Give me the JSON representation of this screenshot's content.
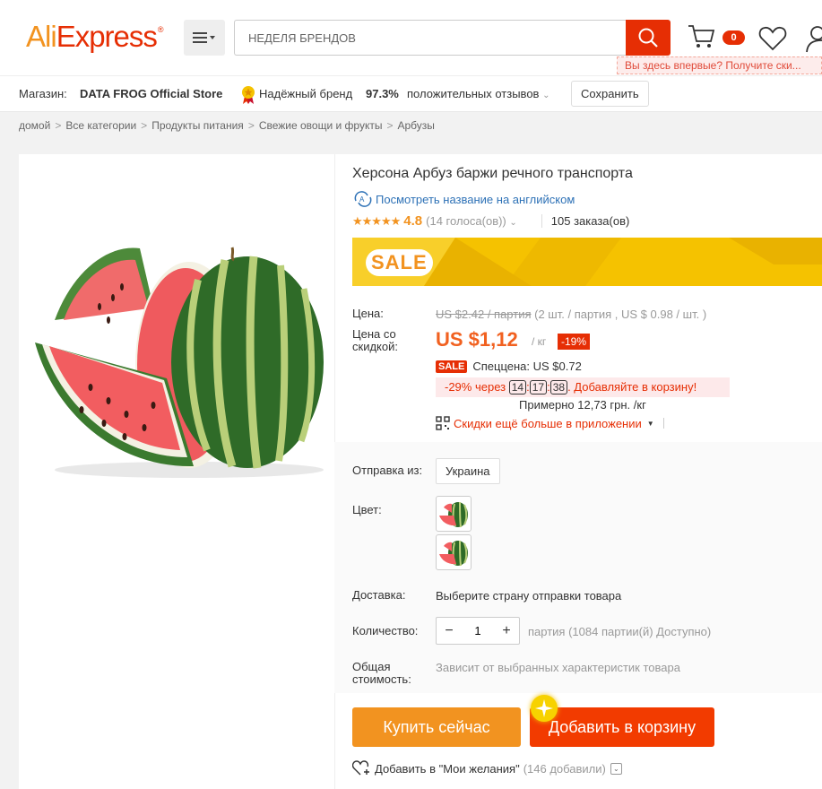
{
  "header": {
    "logo_part1": "Ali",
    "logo_part2": "Express",
    "logo_tm": "®",
    "search_placeholder": "НЕДЕЛЯ БРЕНДОВ",
    "cart_count": "0",
    "tooltip": "Вы здесь впервые? Получите ски..."
  },
  "store": {
    "label": "Магазин:",
    "name": "DATA FROG Official Store",
    "brand_badge": "Надёжный бренд",
    "positive_pct": "97.3%",
    "positive_label": "положительных отзывов",
    "save_button": "Сохранить"
  },
  "breadcrumb": [
    "домой",
    "Все категории",
    "Продукты питания",
    "Свежие овощи и фрукты",
    "Арбузы"
  ],
  "product": {
    "title": "Херсона Арбуз баржи речного транспорта",
    "english_link": "Посмотреть название на английском",
    "stars": "★★★★★",
    "rating": "4.8",
    "votes": "(14 голоса(ов))",
    "orders": "105 заказа(ов)",
    "sale_banner": "SALE"
  },
  "pricing": {
    "price_label": "Цена:",
    "old_price": "US $2.42 / партия",
    "old_price_note": "(2 шт. / партия , US $ 0.98 / шт. )",
    "discount_label": "Цена со скидкой:",
    "price": "US $1,12",
    "unit": "/ кг",
    "discount_pct": "-19%",
    "sale_tag": "SALE",
    "special_price": "Спеццена: US $0.72",
    "timer_pct": "-29%",
    "timer_word": "через",
    "timer_h": "14",
    "timer_m": "17",
    "timer_s": "38",
    "timer_action": ". Добавляйте в корзину!",
    "approx": "Примерно 12,73 грн. /кг",
    "app_discount": "Скидки ещё больше в приложении"
  },
  "options": {
    "ship_from_label": "Отправка из:",
    "ship_from_value": "Украина",
    "color_label": "Цвет:",
    "delivery_label": "Доставка:",
    "delivery_value": "Выберите страну отправки товара",
    "quantity_label": "Количество:",
    "quantity_value": "1",
    "quantity_note": "партия (1084 партии(й) Доступно)",
    "total_label": "Общая стоимость:",
    "total_value": "Зависит от выбранных характеристик товара"
  },
  "actions": {
    "buy_now": "Купить сейчас",
    "add_to_cart": "Добавить в корзину",
    "wishlist": "Добавить в \"Мои желания\"",
    "wishlist_count": "(146 добавили)"
  }
}
